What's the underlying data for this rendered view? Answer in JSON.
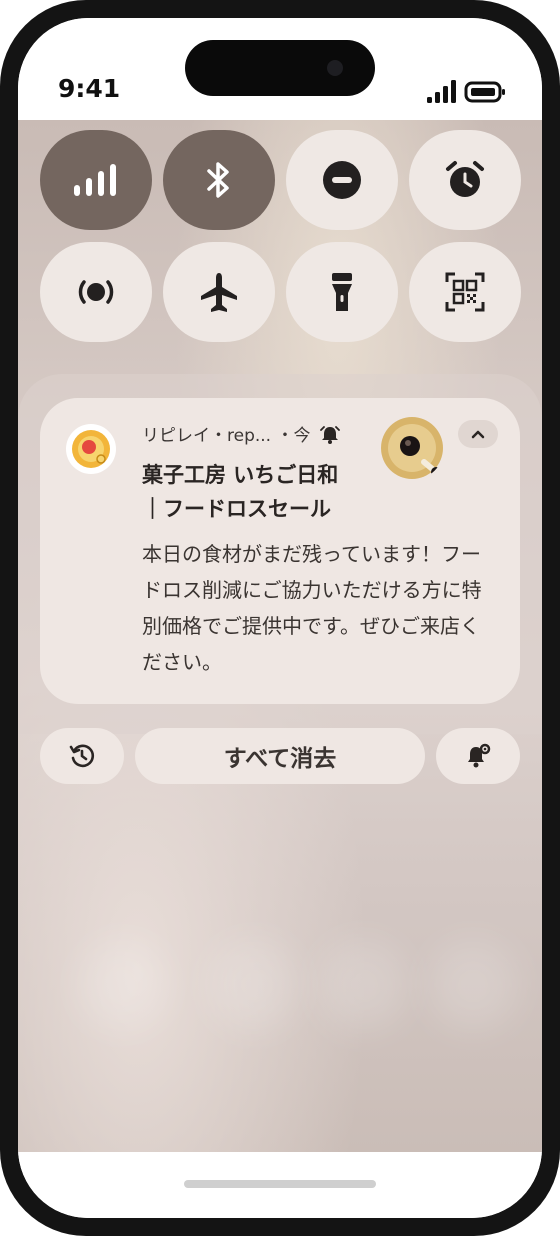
{
  "status_bar": {
    "time": "9:41",
    "icons": [
      "cellular-signal-icon",
      "battery-icon"
    ]
  },
  "quick_settings": {
    "tiles": [
      {
        "name": "mobile-data",
        "icon": "cellular-signal-icon",
        "active": true
      },
      {
        "name": "bluetooth",
        "icon": "bluetooth-icon",
        "active": true
      },
      {
        "name": "do-not-disturb",
        "icon": "do-not-disturb-icon",
        "active": false
      },
      {
        "name": "alarm",
        "icon": "alarm-clock-icon",
        "active": false
      },
      {
        "name": "auto-rotate",
        "icon": "screen-rotate-icon",
        "active": false
      },
      {
        "name": "airplane-mode",
        "icon": "airplane-icon",
        "active": false
      },
      {
        "name": "flashlight",
        "icon": "flashlight-icon",
        "active": false
      },
      {
        "name": "qr-scanner",
        "icon": "qr-code-scan-icon",
        "active": false
      }
    ],
    "colors": {
      "active": "#74665f",
      "inactive": "#efe8e4"
    }
  },
  "notification": {
    "app_name": "リピレイ・rep...",
    "time": "・今",
    "title_line1": "菓子工房 いちご日和",
    "title_line2": "｜フードロスセール",
    "body": "本日の食材がまだ残っています！フードロス削減にご協力いただける方に特別価格でご提供中です。ぜひご来店ください。",
    "icons": [
      "app-logo-icon",
      "alarm-bell-icon",
      "expand-collapse-icon",
      "food-thumbnail-image"
    ]
  },
  "actions": {
    "history_icon": "history-icon",
    "clear_all": "すべて消去",
    "settings_icon": "notification-settings-icon"
  }
}
